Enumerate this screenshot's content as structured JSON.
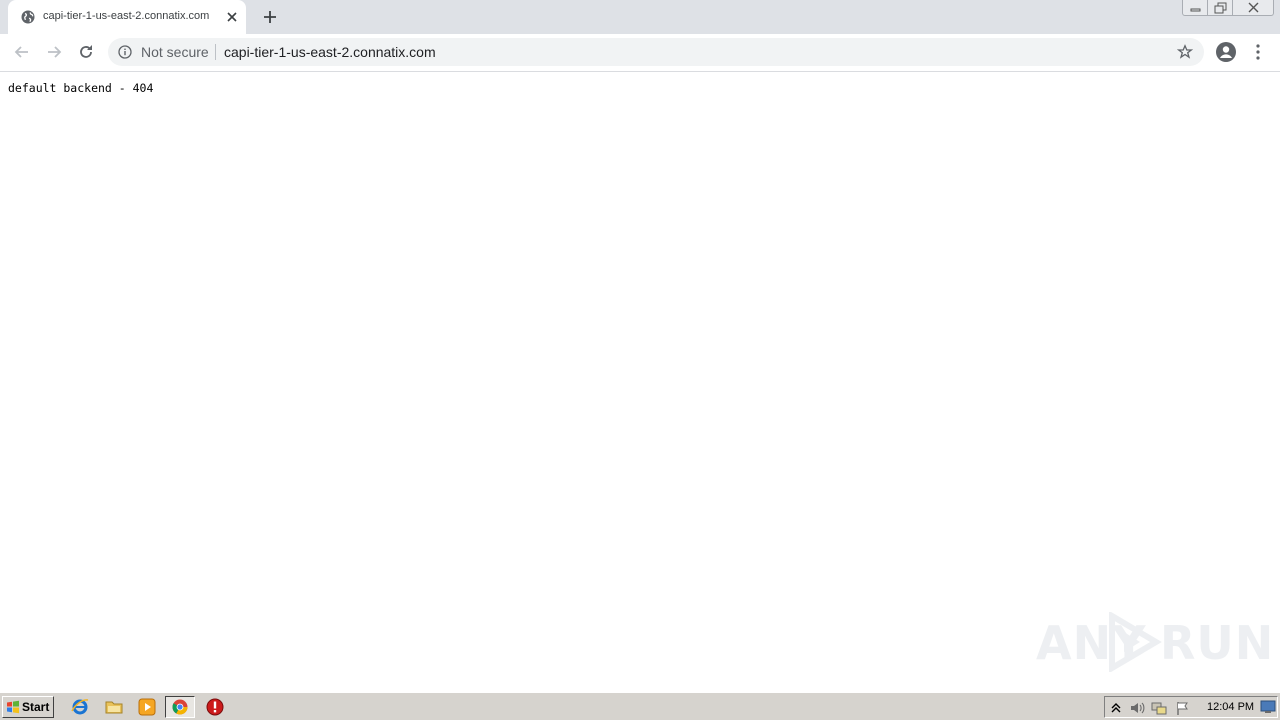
{
  "browser": {
    "tab_title": "capi-tier-1-us-east-2.connatix.com",
    "security_label": "Not secure",
    "url": "capi-tier-1-us-east-2.connatix.com"
  },
  "page": {
    "body_text": "default backend - 404"
  },
  "watermark": {
    "text_left": "ANY",
    "text_right": "RUN"
  },
  "taskbar": {
    "start_label": "Start",
    "clock": "12:04 PM"
  },
  "colors": {
    "tabstrip_bg": "#dee1e6",
    "omnibox_bg": "#f1f3f4",
    "taskbar_bg": "#d6d3ce"
  }
}
